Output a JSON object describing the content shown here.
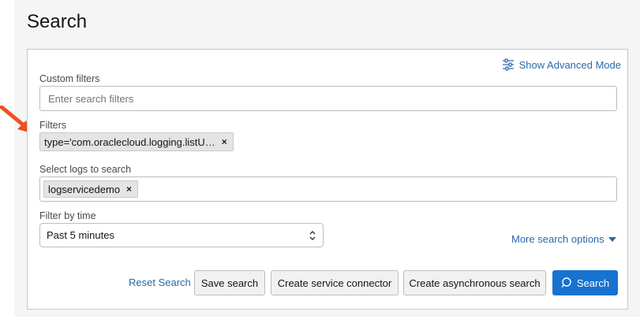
{
  "page": {
    "title": "Search"
  },
  "advanced_mode": {
    "label": "Show Advanced Mode",
    "icon": "sliders-icon"
  },
  "custom_filters": {
    "label": "Custom filters",
    "placeholder": "Enter search filters",
    "value": ""
  },
  "filters": {
    "label": "Filters",
    "chips": [
      {
        "text": "type='com.oraclecloud.logging.listU…"
      }
    ]
  },
  "logs": {
    "label": "Select logs to search",
    "chips": [
      {
        "text": "logservicedemo"
      }
    ]
  },
  "time_filter": {
    "label": "Filter by time",
    "selected": "Past 5 minutes"
  },
  "more_options": {
    "label": "More search options"
  },
  "actions": {
    "reset": "Reset Search",
    "save": "Save search",
    "connector": "Create service connector",
    "async": "Create asynchronous search",
    "search": "Search"
  },
  "colors": {
    "accent": "#1772d0",
    "link": "#2a69a8",
    "arrow": "#f0501e"
  },
  "chip_remove_glyph": "×"
}
